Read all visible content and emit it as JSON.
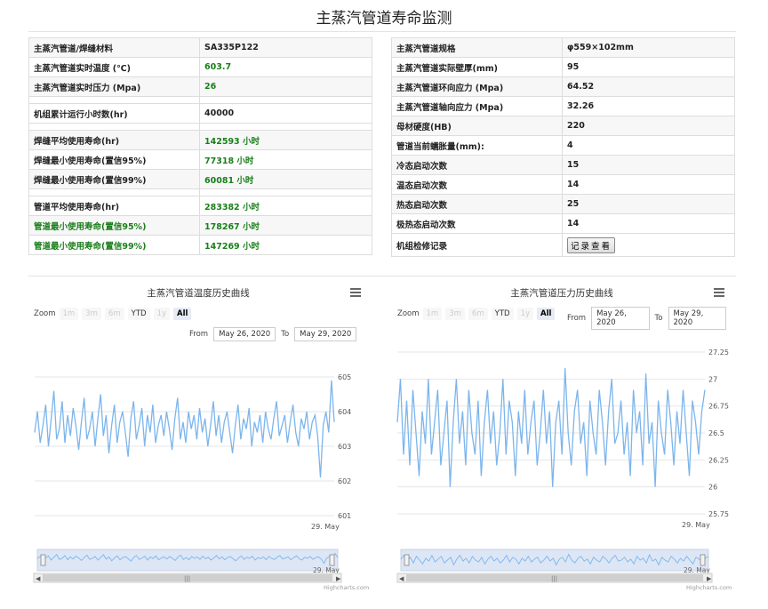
{
  "page": {
    "title": "主蒸汽管道寿命监测"
  },
  "left_table": [
    {
      "k": "主蒸汽管道/焊缝材料",
      "v": "SA335P122",
      "h": "r22",
      "alt": true,
      "vg": false,
      "kg": false
    },
    {
      "k": "主蒸汽管道实时温度 (℃)",
      "v": "603.7",
      "h": "r22",
      "alt": false,
      "vg": true,
      "kg": false
    },
    {
      "k": "主蒸汽管道实时压力 (Mpa)",
      "v": "26",
      "h": "r22",
      "alt": true,
      "vg": true,
      "kg": false
    },
    {
      "k": "",
      "v": "",
      "h": "r8",
      "alt": false,
      "vg": false,
      "kg": false
    },
    {
      "k": "机组累计运行小时数(hr)",
      "v": "40000",
      "h": "r22",
      "alt": false,
      "vg": false,
      "kg": false
    },
    {
      "k": "",
      "v": "",
      "h": "r8",
      "alt": false,
      "vg": false,
      "kg": false
    },
    {
      "k": "焊缝平均使用寿命(hr)",
      "v": "142593 小时",
      "h": "r22",
      "alt": true,
      "vg": true,
      "kg": false
    },
    {
      "k": "焊缝最小使用寿命(置信95%)",
      "v": "77318 小时",
      "h": "r22",
      "alt": false,
      "vg": true,
      "kg": false
    },
    {
      "k": "焊缝最小使用寿命(置信99%)",
      "v": "60081 小时",
      "h": "r22",
      "alt": true,
      "vg": true,
      "kg": false
    },
    {
      "k": "",
      "v": "",
      "h": "r8",
      "alt": false,
      "vg": false,
      "kg": false
    },
    {
      "k": "管道平均使用寿命(hr)",
      "v": "283382 小时",
      "h": "r22",
      "alt": false,
      "vg": true,
      "kg": false
    },
    {
      "k": "管道最小使用寿命(置信95%)",
      "v": "178267 小时",
      "h": "r22",
      "alt": true,
      "vg": true,
      "kg": true
    },
    {
      "k": "管道最小使用寿命(置信99%)",
      "v": "147269 小时",
      "h": "r22",
      "alt": false,
      "vg": true,
      "kg": true
    }
  ],
  "right_table": [
    {
      "k": "主蒸汽管道规格",
      "v": "φ559×102mm",
      "h": "r22",
      "alt": true
    },
    {
      "k": "主蒸汽管道实际壁厚(mm)",
      "v": "95",
      "h": "r22",
      "alt": false
    },
    {
      "k": "主蒸汽管道环向应力 (Mpa)",
      "v": "64.52",
      "h": "r22",
      "alt": true
    },
    {
      "k": "主蒸汽管道轴向应力 (Mpa)",
      "v": "32.26",
      "h": "r22",
      "alt": false
    },
    {
      "k": "母材硬度(HB)",
      "v": "220",
      "h": "r22",
      "alt": true
    },
    {
      "k": "管道当前蠕胀量(mm):",
      "v": "4",
      "h": "r22",
      "alt": false
    },
    {
      "k": "冷态启动次数",
      "v": "15",
      "h": "r22",
      "alt": true
    },
    {
      "k": "温态启动次数",
      "v": "14",
      "h": "r22",
      "alt": false
    },
    {
      "k": "热态启动次数",
      "v": "25",
      "h": "r22",
      "alt": true
    },
    {
      "k": "极热态启动次数",
      "v": "14",
      "h": "r22",
      "alt": false
    }
  ],
  "maintenance": {
    "label": "机组检修记录",
    "button": "记录查看"
  },
  "zoom_labels": {
    "zoom": "Zoom",
    "buttons": [
      "1m",
      "3m",
      "6m",
      "YTD",
      "1y",
      "All"
    ],
    "from": "From",
    "to": "To"
  },
  "credits": "Highcharts.com",
  "charts": [
    {
      "title": "主蒸汽管道温度历史曲线",
      "from_date": "May 26, 2020",
      "to_date": "May 29, 2020",
      "x_end_label": "29. May",
      "nav_end_label": "29. May",
      "axis_side": "right",
      "color": "#7cb5ec"
    },
    {
      "title": "主蒸汽管道压力历史曲线",
      "from_date": "May 26, 2020",
      "to_date": "May 29, 2020",
      "x_end_label": "29. May",
      "nav_end_label": "29. May",
      "axis_side": "right",
      "color": "#7cb5ec"
    }
  ],
  "chart_data": [
    {
      "type": "line",
      "title": "主蒸汽管道温度历史曲线",
      "x_start": "May 26, 2020",
      "x_end": "May 29, 2020",
      "ylim": [
        601,
        605
      ],
      "y_ticks": [
        601,
        602,
        603,
        604,
        605
      ],
      "x_tick_labels": [
        "29. May"
      ],
      "series": [
        {
          "values": [
            603.4,
            604.0,
            603.1,
            603.6,
            604.2,
            603.0,
            603.8,
            604.6,
            603.2,
            603.5,
            604.3,
            603.1,
            603.9,
            603.3,
            604.1,
            603.6,
            602.9,
            603.7,
            604.4,
            603.2,
            603.5,
            604.0,
            603.0,
            603.8,
            604.5,
            603.3,
            603.9,
            602.8,
            603.6,
            604.2,
            603.1,
            603.7,
            604.0,
            603.4,
            602.7,
            603.8,
            604.3,
            603.2,
            603.6,
            604.1,
            603.0,
            603.9,
            603.4,
            604.2,
            603.1,
            603.6,
            603.9,
            603.3,
            604.0,
            603.5,
            602.9,
            603.8,
            604.4,
            603.2,
            603.7,
            603.1,
            604.0,
            603.5,
            603.9,
            603.2,
            604.1,
            603.4,
            603.8,
            603.0,
            603.6,
            604.3,
            603.3,
            603.9,
            603.1,
            603.7,
            604.0,
            603.4,
            602.8,
            603.6,
            604.2,
            603.2,
            603.8,
            603.5,
            604.1,
            603.0,
            603.7,
            603.4,
            603.9,
            603.1,
            604.0,
            603.5,
            603.2,
            603.8,
            604.3,
            603.3,
            603.6,
            603.9,
            603.1,
            603.7,
            604.2,
            603.4,
            603.0,
            603.8,
            603.5,
            604.0,
            603.2,
            603.7,
            603.9,
            603.3,
            602.1,
            603.6,
            604.0,
            603.4,
            604.9,
            603.7
          ]
        }
      ]
    },
    {
      "type": "line",
      "title": "主蒸汽管道压力历史曲线",
      "x_start": "May 26, 2020",
      "x_end": "May 29, 2020",
      "ylim": [
        25.75,
        27.25
      ],
      "y_ticks": [
        25.75,
        26,
        26.25,
        26.5,
        26.75,
        27,
        27.25
      ],
      "x_tick_labels": [
        "29. May"
      ],
      "series": [
        {
          "values": [
            26.6,
            27.0,
            26.3,
            26.8,
            26.2,
            26.9,
            26.5,
            26.1,
            26.7,
            26.4,
            27.0,
            26.3,
            26.6,
            26.9,
            26.2,
            26.5,
            26.8,
            26.0,
            26.6,
            27.0,
            26.4,
            26.7,
            26.2,
            26.9,
            26.5,
            26.3,
            26.8,
            26.1,
            26.6,
            26.9,
            26.4,
            26.7,
            26.2,
            26.5,
            27.0,
            26.3,
            26.8,
            26.6,
            26.1,
            26.7,
            26.4,
            26.9,
            26.3,
            26.6,
            26.8,
            26.2,
            26.5,
            26.9,
            26.4,
            26.7,
            26.0,
            26.6,
            26.8,
            26.3,
            27.1,
            26.5,
            26.2,
            26.7,
            26.9,
            26.4,
            26.6,
            26.1,
            26.8,
            26.5,
            26.3,
            26.9,
            26.6,
            26.2,
            26.7,
            27.0,
            26.4,
            26.5,
            26.8,
            26.3,
            26.6,
            26.1,
            26.9,
            26.5,
            26.7,
            26.2,
            27.05,
            26.4,
            26.6,
            26.0,
            26.8,
            26.5,
            26.3,
            26.9,
            26.6,
            26.2,
            26.7,
            26.4,
            26.9,
            26.5,
            26.1,
            26.8,
            26.6,
            26.3,
            26.7,
            26.9
          ]
        }
      ]
    }
  ]
}
